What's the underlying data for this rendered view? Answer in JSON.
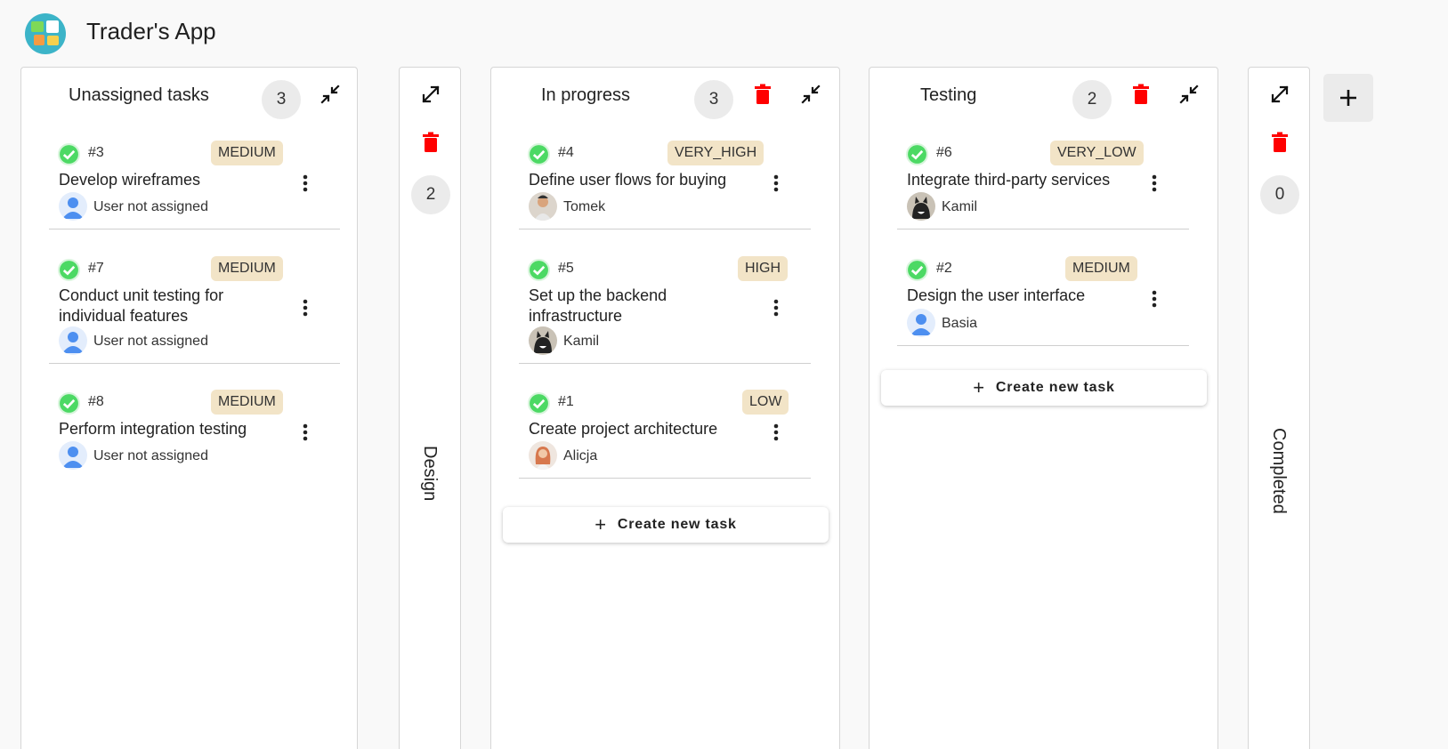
{
  "app": {
    "title": "Trader's App"
  },
  "columns": [
    {
      "title": "Unassigned tasks",
      "count": "3",
      "tasks": [
        {
          "id": "#3",
          "priority": "MEDIUM",
          "title": "Develop wireframes",
          "user": "User not assigned"
        },
        {
          "id": "#7",
          "priority": "MEDIUM",
          "title": "Conduct unit testing for individual features",
          "user": "User not assigned"
        },
        {
          "id": "#8",
          "priority": "MEDIUM",
          "title": "Perform integration testing",
          "user": "User not assigned"
        }
      ]
    },
    {
      "title": "Design",
      "count": "2",
      "collapsed": true
    },
    {
      "title": "In progress",
      "count": "3",
      "tasks": [
        {
          "id": "#4",
          "priority": "VERY_HIGH",
          "title": "Define user flows for buying",
          "user": "Tomek"
        },
        {
          "id": "#5",
          "priority": "HIGH",
          "title": "Set up the backend infrastructure",
          "user": "Kamil"
        },
        {
          "id": "#1",
          "priority": "LOW",
          "title": "Create project architecture",
          "user": "Alicja"
        }
      ],
      "create_label": "Create new task"
    },
    {
      "title": "Testing",
      "count": "2",
      "tasks": [
        {
          "id": "#6",
          "priority": "VERY_LOW",
          "title": "Integrate third-party services",
          "user": "Kamil"
        },
        {
          "id": "#2",
          "priority": "MEDIUM",
          "title": "Design the user interface",
          "user": "Basia"
        }
      ],
      "create_label": "Create new task"
    },
    {
      "title": "Completed",
      "count": "0",
      "collapsed": true
    }
  ],
  "icons": {
    "collapse": "collapse-arrows-icon",
    "expand": "expand-arrows-icon",
    "delete": "trash-icon",
    "more": "more-vert-icon",
    "done": "check-circle-icon",
    "add": "plus-icon"
  },
  "colors": {
    "delete": "#ff0000",
    "check": "#4cd964",
    "priority_bg": "#f2e4c7",
    "avatar_default": "#4d8ff0"
  }
}
